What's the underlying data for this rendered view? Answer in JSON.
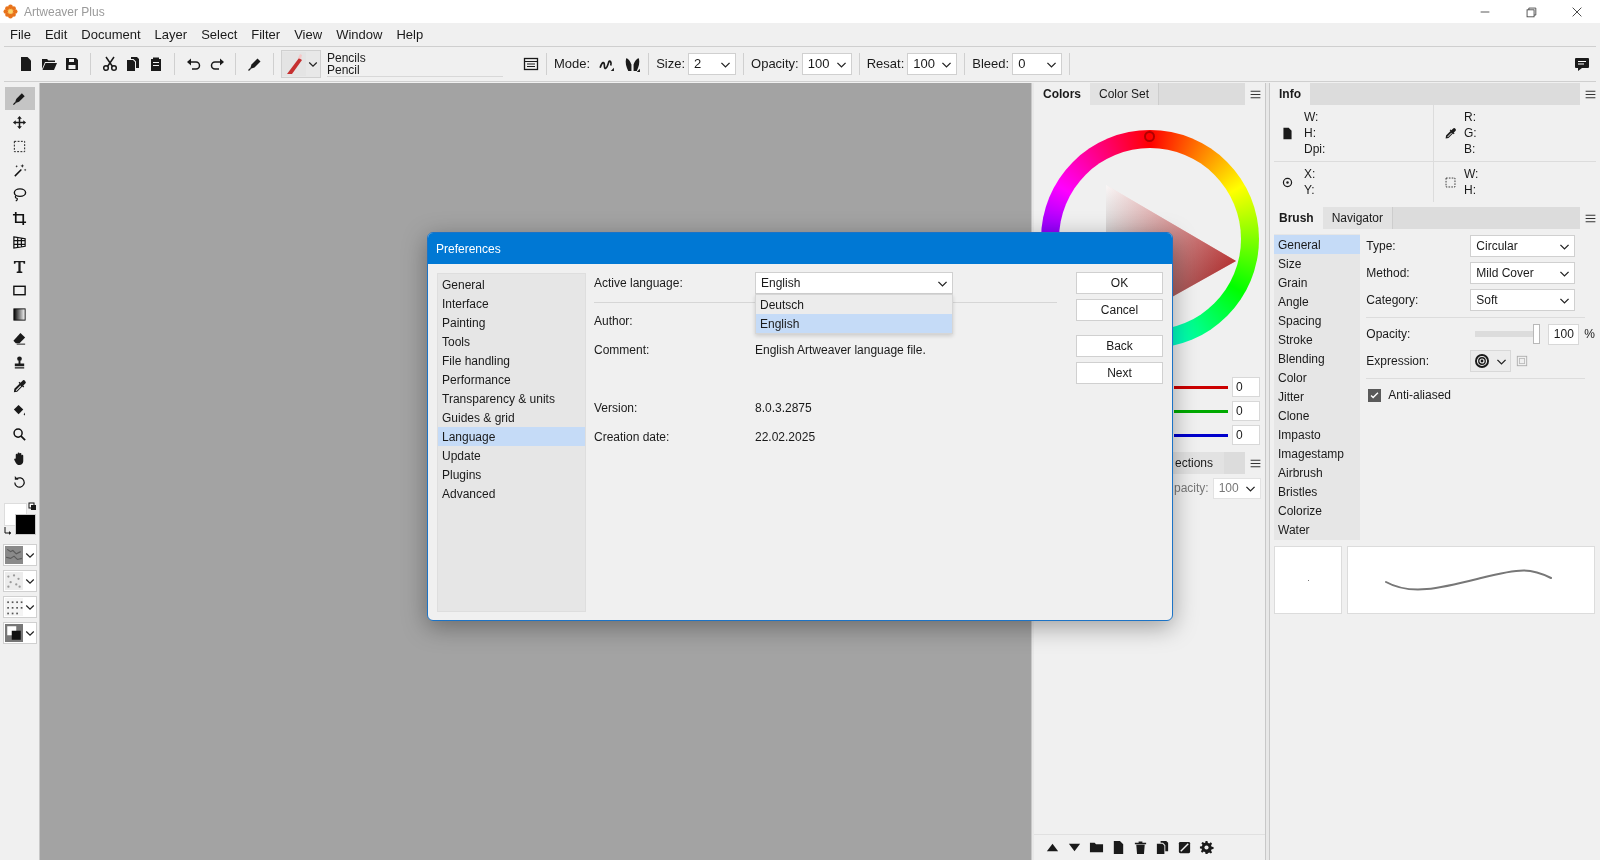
{
  "window": {
    "title": "Artweaver Plus"
  },
  "menu": [
    "File",
    "Edit",
    "Document",
    "Layer",
    "Select",
    "Filter",
    "View",
    "Window",
    "Help"
  ],
  "toolbar": {
    "brush_category": "Pencils",
    "brush_name": "Pencil",
    "mode_label": "Mode:",
    "fields": [
      {
        "label": "Size:",
        "value": "2"
      },
      {
        "label": "Opacity:",
        "value": "100"
      },
      {
        "label": "Resat:",
        "value": "100"
      },
      {
        "label": "Bleed:",
        "value": "0"
      }
    ]
  },
  "tools": [
    {
      "selected": true
    },
    {
      "selected": false
    },
    {
      "selected": false
    },
    {
      "selected": false
    },
    {
      "selected": false
    },
    {
      "selected": false
    },
    {
      "selected": false
    },
    {
      "selected": false
    },
    {
      "selected": false
    },
    {
      "selected": false
    },
    {
      "selected": false
    },
    {
      "selected": false
    },
    {
      "selected": false
    },
    {
      "selected": false
    },
    {
      "selected": false
    },
    {
      "selected": false
    },
    {
      "selected": false
    }
  ],
  "colors_panel": {
    "tabs": [
      {
        "label": "Colors",
        "selected": true
      },
      {
        "label": "Color Set",
        "selected": false
      }
    ],
    "channels": [
      {
        "color": "#cc0000",
        "value": "0"
      },
      {
        "color": "#00aa00",
        "value": "0"
      },
      {
        "color": "#0000cc",
        "value": "0"
      }
    ],
    "layers_tab": "ections",
    "layer_opacity_label": "pacity:",
    "layer_opacity_value": "100"
  },
  "info_panel": {
    "tabs": [
      {
        "label": "Info",
        "selected": true
      }
    ],
    "document_labels": [
      "W:",
      "H:",
      "Dpi:"
    ],
    "color_labels": [
      "R:",
      "G:",
      "B:"
    ],
    "position_labels": [
      "X:",
      "Y:"
    ],
    "selection_labels": [
      "W:",
      "H:"
    ]
  },
  "brush_panel": {
    "tabs": [
      {
        "label": "Brush",
        "selected": true
      },
      {
        "label": "Navigator",
        "selected": false
      }
    ],
    "categories": [
      {
        "label": "General",
        "selected": true
      },
      {
        "label": "Size",
        "selected": false
      },
      {
        "label": "Grain",
        "selected": false
      },
      {
        "label": "Angle",
        "selected": false
      },
      {
        "label": "Spacing",
        "selected": false
      },
      {
        "label": "Stroke",
        "selected": false
      },
      {
        "label": "Blending",
        "selected": false
      },
      {
        "label": "Color",
        "selected": false
      },
      {
        "label": "Jitter",
        "selected": false
      },
      {
        "label": "Clone",
        "selected": false
      },
      {
        "label": "Impasto",
        "selected": false
      },
      {
        "label": "Imagestamp",
        "selected": false
      },
      {
        "label": "Airbrush",
        "selected": false
      },
      {
        "label": "Bristles",
        "selected": false
      },
      {
        "label": "Colorize",
        "selected": false
      },
      {
        "label": "Water",
        "selected": false
      }
    ],
    "type": {
      "label": "Type:",
      "value": "Circular"
    },
    "method": {
      "label": "Method:",
      "value": "Mild Cover"
    },
    "category": {
      "label": "Category:",
      "value": "Soft"
    },
    "opacity": {
      "label": "Opacity:",
      "value": "100",
      "unit": "%",
      "level": 1
    },
    "expression_label": "Expression:",
    "anti_aliased": {
      "label": "Anti-aliased",
      "checked": true
    }
  },
  "dialog": {
    "title": "Preferences",
    "sections": [
      {
        "label": "General",
        "selected": false
      },
      {
        "label": "Interface",
        "selected": false
      },
      {
        "label": "Painting",
        "selected": false
      },
      {
        "label": "Tools",
        "selected": false
      },
      {
        "label": "File handling",
        "selected": false
      },
      {
        "label": "Performance",
        "selected": false
      },
      {
        "label": "Transparency & units",
        "selected": false
      },
      {
        "label": "Guides & grid",
        "selected": false
      },
      {
        "label": "Language",
        "selected": true
      },
      {
        "label": "Update",
        "selected": false
      },
      {
        "label": "Plugins",
        "selected": false
      },
      {
        "label": "Advanced",
        "selected": false
      }
    ],
    "active_language": {
      "label": "Active language:",
      "value": "English",
      "options": [
        {
          "label": "Deutsch",
          "selected": false
        },
        {
          "label": "English",
          "selected": true
        }
      ]
    },
    "fields": [
      {
        "label": "Author:"
      },
      {
        "label": "Comment:",
        "value": "English Artweaver language file."
      },
      {
        "label": "Version:",
        "value": "8.0.3.2875"
      },
      {
        "label": "Creation date:",
        "value": "22.02.2025"
      }
    ],
    "buttons": [
      "OK",
      "Cancel",
      "Back",
      "Next"
    ]
  }
}
